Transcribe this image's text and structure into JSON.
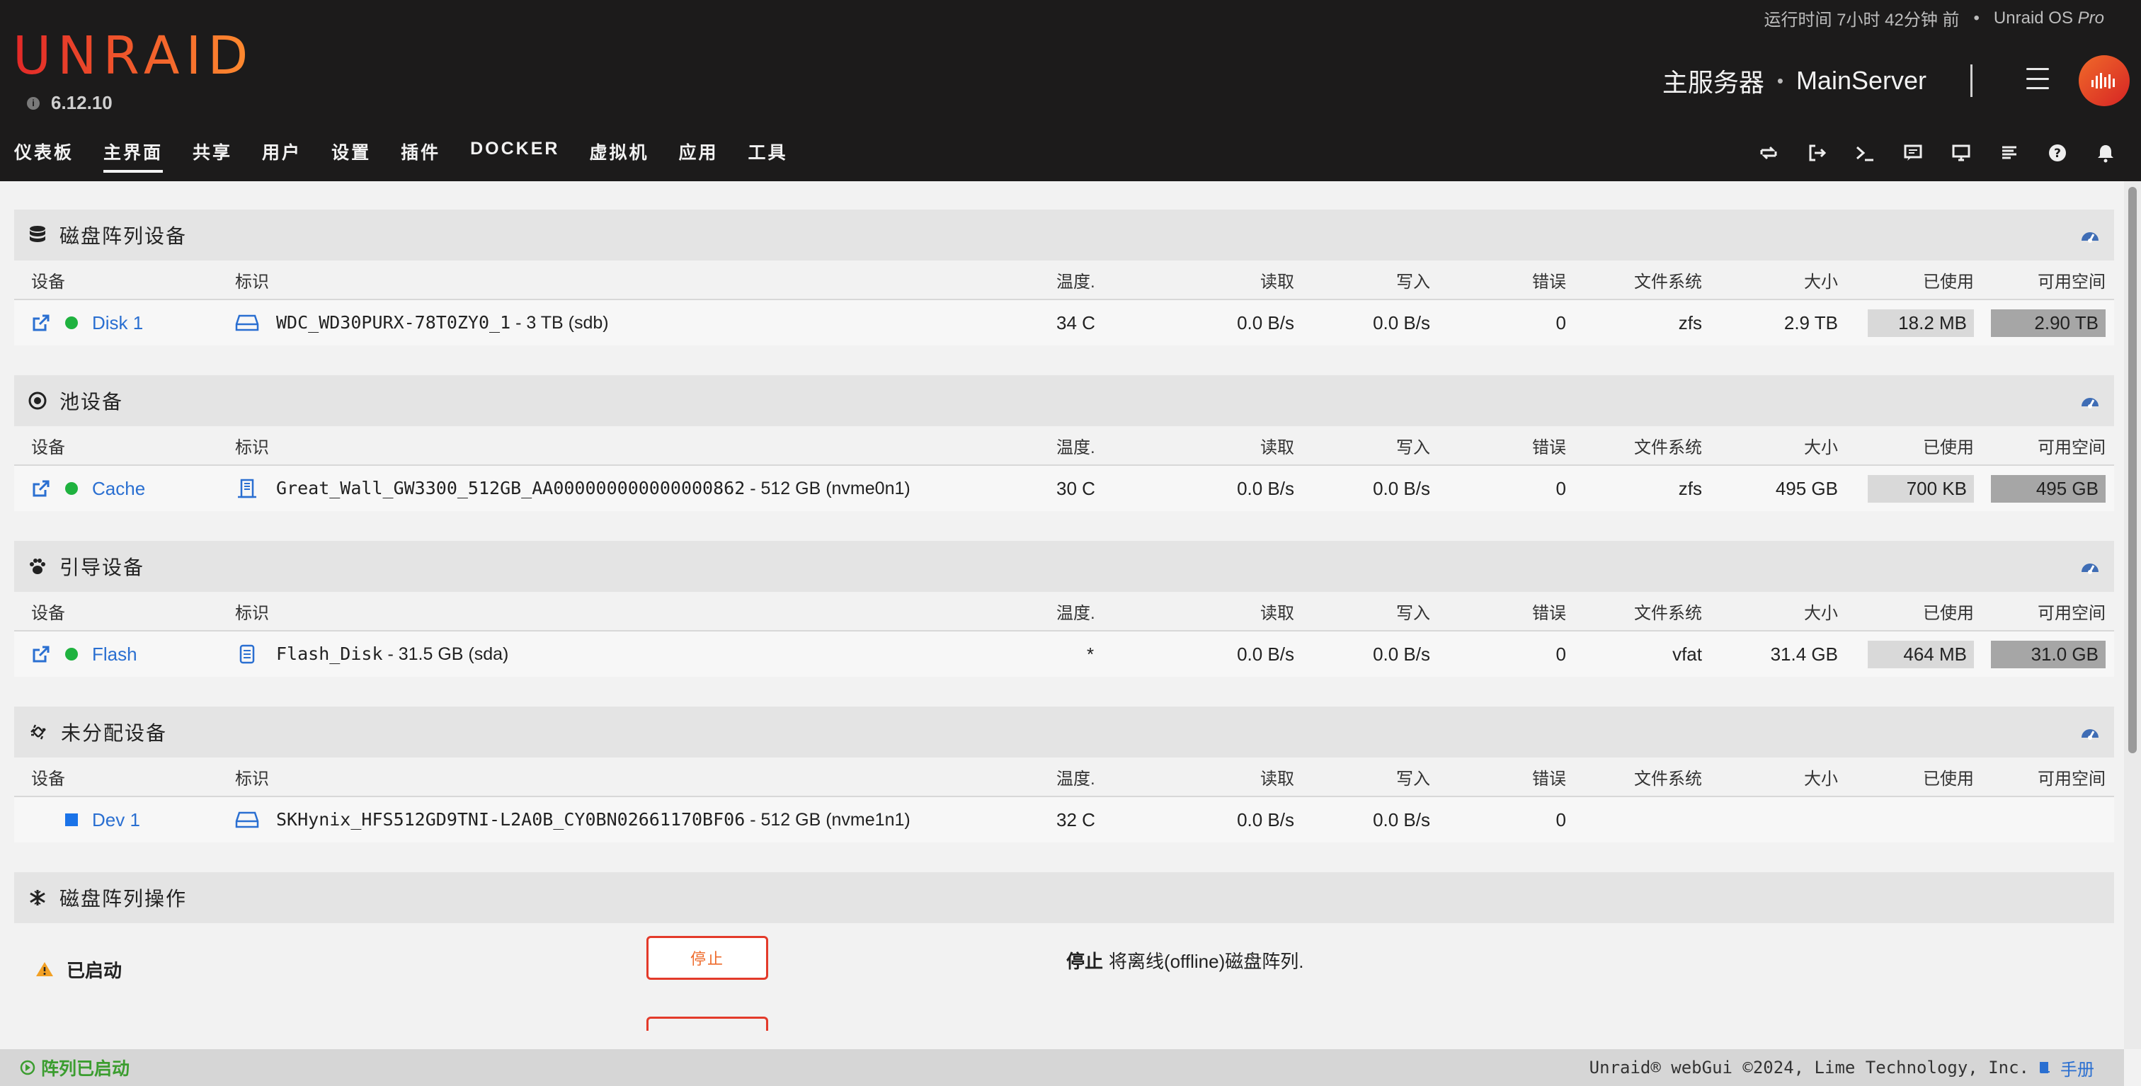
{
  "header": {
    "logo": "UNRAID",
    "version": "6.12.10",
    "uptime": "运行时间 7小时 42分钟 前",
    "bullet": "•",
    "os_prefix": "Unraid OS",
    "os_edition": "Pro",
    "server_desc": "主服务器",
    "server_dot": "•",
    "server_name": "MainServer"
  },
  "nav": [
    {
      "label": "仪表板"
    },
    {
      "label": "主界面"
    },
    {
      "label": "共享"
    },
    {
      "label": "用户"
    },
    {
      "label": "设置"
    },
    {
      "label": "插件"
    },
    {
      "label": "DOCKER"
    },
    {
      "label": "虚拟机"
    },
    {
      "label": "应用"
    },
    {
      "label": "工具"
    }
  ],
  "columns": {
    "device": "设备",
    "ident": "标识",
    "temp": "温度.",
    "read": "读取",
    "write": "写入",
    "errors": "错误",
    "fs": "文件系统",
    "size": "大小",
    "used": "已使用",
    "free": "可用空间"
  },
  "panels": {
    "array": {
      "title": "磁盘阵列设备",
      "row": {
        "device": "Disk 1",
        "ident_mono": "WDC_WD30PURX-78T0ZY0_1",
        "ident_rest": " - 3 TB (sdb)",
        "temp": "34 C",
        "read": "0.0 B/s",
        "write": "0.0 B/s",
        "errors": "0",
        "fs": "zfs",
        "size": "2.9 TB",
        "used": "18.2 MB",
        "free": "2.90 TB"
      }
    },
    "pool": {
      "title": "池设备",
      "row": {
        "device": "Cache",
        "ident_mono": "Great_Wall_GW3300_512GB_AA000000000000000862",
        "ident_rest": " - 512 GB (nvme0n1)",
        "temp": "30 C",
        "read": "0.0 B/s",
        "write": "0.0 B/s",
        "errors": "0",
        "fs": "zfs",
        "size": "495 GB",
        "used": "700 KB",
        "free": "495 GB"
      }
    },
    "boot": {
      "title": "引导设备",
      "row": {
        "device": "Flash",
        "ident_mono": "Flash_Disk",
        "ident_rest": " - 31.5 GB (sda)",
        "temp": "*",
        "read": "0.0 B/s",
        "write": "0.0 B/s",
        "errors": "0",
        "fs": "vfat",
        "size": "31.4 GB",
        "used": "464 MB",
        "free": "31.0 GB"
      }
    },
    "unassigned": {
      "title": "未分配设备",
      "row": {
        "device": "Dev 1",
        "ident_mono": "SKHynix_HFS512GD9TNI-L2A0B_CY0BN02661170BF06",
        "ident_rest": " - 512 GB (nvme1n1)",
        "temp": "32 C",
        "read": "0.0 B/s",
        "write": "0.0 B/s",
        "errors": "0"
      }
    },
    "ops": {
      "title": "磁盘阵列操作",
      "status": "已启动",
      "stop_label": "停止",
      "desc_bold": "停止",
      "desc_rest": "将离线(offline)磁盘阵列."
    }
  },
  "footer": {
    "array_state": "阵列已启动",
    "copyright": "Unraid® webGui ©2024, Lime Technology, Inc.",
    "manual": "手册"
  },
  "colors": {
    "accent_start": "#e22828",
    "accent_end": "#ff8c2f",
    "status_green": "#1fb23f",
    "link_blue": "#2a6fd1",
    "stop_red": "#e33a2a"
  }
}
